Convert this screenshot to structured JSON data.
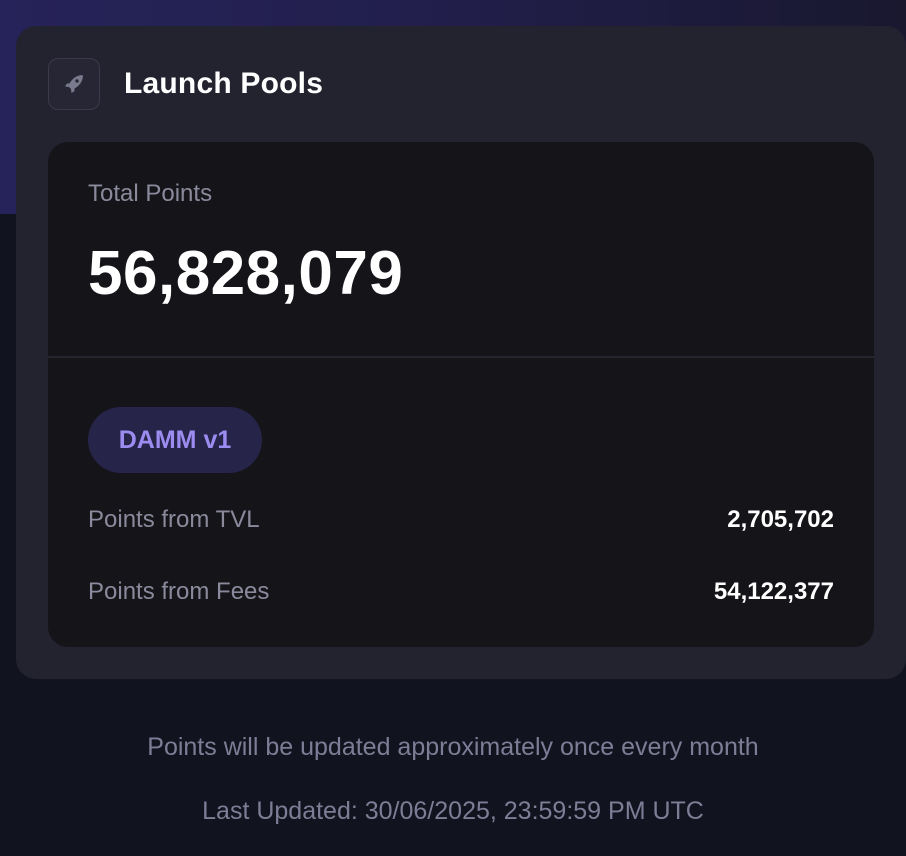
{
  "section": {
    "title": "Launch Pools",
    "icon": "rocket-icon"
  },
  "total": {
    "label": "Total Points",
    "value": "56,828,079"
  },
  "pool": {
    "badge": "DAMM v1",
    "rows": [
      {
        "label": "Points from TVL",
        "value": "2,705,702"
      },
      {
        "label": "Points from Fees",
        "value": "54,122,377"
      }
    ]
  },
  "footer": {
    "update_note": "Points will be updated approximately once every month",
    "last_updated": "Last Updated: 30/06/2025, 23:59:59 PM UTC"
  },
  "colors": {
    "badge_text": "#9c8cf0",
    "badge_bg": "#27244a",
    "card_bg": "#232330",
    "inner_bg": "#141419"
  }
}
